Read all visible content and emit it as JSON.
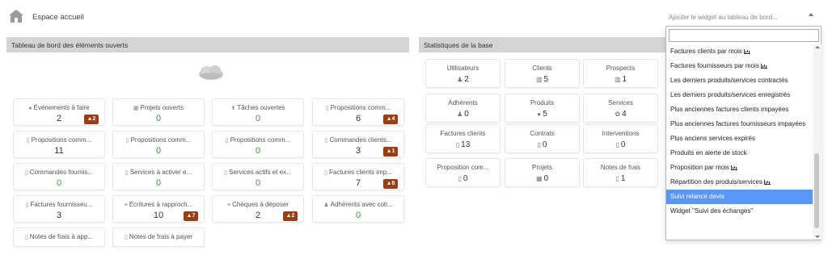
{
  "page": {
    "title": "Espace accueil",
    "left_panel_title": "Tableau de bord des éléments ouverts",
    "right_panel_title": "Statistiques de la base"
  },
  "open_items": [
    {
      "icon": "calendar-icon",
      "glyph": "●",
      "label": "Événements à faire",
      "value": "2",
      "warning": "2"
    },
    {
      "icon": "project-icon",
      "glyph": "▦",
      "label": "Projets ouverts",
      "value": "0",
      "warning": ""
    },
    {
      "icon": "task-icon",
      "glyph": "⬆",
      "label": "Tâches ouvertes",
      "value": "0",
      "warning": ""
    },
    {
      "icon": "proposal-icon",
      "glyph": "▯",
      "label": "Propositions comm...",
      "value": "6",
      "warning": "4"
    },
    {
      "icon": "proposal-icon",
      "glyph": "▯",
      "label": "Propositions comm...",
      "value": "11",
      "warning": ""
    },
    {
      "icon": "proposal-icon",
      "glyph": "▯",
      "label": "Propositions comm...",
      "value": "0",
      "warning": ""
    },
    {
      "icon": "proposal-icon",
      "glyph": "▯",
      "label": "Propositions comm...",
      "value": "0",
      "warning": ""
    },
    {
      "icon": "order-icon",
      "glyph": "▯",
      "label": "Commandes clients...",
      "value": "3",
      "warning": "1"
    },
    {
      "icon": "supplier-order-icon",
      "glyph": "▯",
      "label": "Commandes fournis...",
      "value": "0",
      "warning": ""
    },
    {
      "icon": "service-icon",
      "glyph": "▯",
      "label": "Services à activer e...",
      "value": "0",
      "warning": ""
    },
    {
      "icon": "service-icon",
      "glyph": "▯",
      "label": "Services actifs et ex...",
      "value": "0",
      "warning": ""
    },
    {
      "icon": "invoice-icon",
      "glyph": "▯",
      "label": "Factures clients imp...",
      "value": "7",
      "warning": "6"
    },
    {
      "icon": "supplier-invoice-icon",
      "glyph": "▯",
      "label": "Factures fournisseu...",
      "value": "3",
      "warning": ""
    },
    {
      "icon": "bank-icon",
      "glyph": "≡",
      "label": "Écritures à rapproch...",
      "value": "10",
      "warning": "7"
    },
    {
      "icon": "cheque-icon",
      "glyph": "≡",
      "label": "Chèques à déposer",
      "value": "2",
      "warning": "2"
    },
    {
      "icon": "member-icon",
      "glyph": "♟",
      "label": "Adhérents avec coti...",
      "value": "0",
      "warning": ""
    },
    {
      "icon": "expense-icon",
      "glyph": "▯",
      "label": "Notes de frais à app...",
      "value": "",
      "warning": ""
    },
    {
      "icon": "expense-icon",
      "glyph": "▯",
      "label": "Notes de frais à payer",
      "value": "",
      "warning": ""
    }
  ],
  "stats": [
    {
      "icon": "user-icon",
      "glyph": "♟",
      "label": "Utilisateurs",
      "value": "2"
    },
    {
      "icon": "company-icon",
      "glyph": "▥",
      "label": "Clients",
      "value": "5"
    },
    {
      "icon": "company-icon",
      "glyph": "▥",
      "label": "Prospects",
      "value": "1"
    },
    {
      "icon": "member-icon",
      "glyph": "♟",
      "label": "Adhérents",
      "value": "0"
    },
    {
      "icon": "product-icon",
      "glyph": "●",
      "label": "Produits",
      "value": "5"
    },
    {
      "icon": "service-icon",
      "glyph": "✿",
      "label": "Services",
      "value": "4"
    },
    {
      "icon": "invoice-icon",
      "glyph": "▯",
      "label": "Factures clients",
      "value": "13"
    },
    {
      "icon": "contract-icon",
      "glyph": "▯",
      "label": "Contrats",
      "value": "0"
    },
    {
      "icon": "intervention-icon",
      "glyph": "▯",
      "label": "Interventions",
      "value": "0"
    },
    {
      "icon": "proposal-icon",
      "glyph": "▯",
      "label": "Proposition com...",
      "value": "0"
    },
    {
      "icon": "project-icon",
      "glyph": "▦",
      "label": "Projets",
      "value": "0"
    },
    {
      "icon": "expense-icon",
      "glyph": "▯",
      "label": "Notes de frais",
      "value": "1"
    }
  ],
  "widget_select": {
    "placeholder": "Ajouter le widget au tableau de bord...",
    "search_value": "",
    "options": [
      {
        "label": "Factures clients par mois",
        "chart": true,
        "highlighted": false
      },
      {
        "label": "Factures fournisseurs par mois",
        "chart": true,
        "highlighted": false
      },
      {
        "label": "Les derniers produits/services contractés",
        "chart": false,
        "highlighted": false
      },
      {
        "label": "Les derniers produits/services enregistrés",
        "chart": false,
        "highlighted": false
      },
      {
        "label": "Plus anciennes factures clients impayées",
        "chart": false,
        "highlighted": false
      },
      {
        "label": "Plus anciennes factures fournisseurs impayées",
        "chart": false,
        "highlighted": false
      },
      {
        "label": "Plus anciens services expirés",
        "chart": false,
        "highlighted": false
      },
      {
        "label": "Produits en alerte de stock",
        "chart": false,
        "highlighted": false
      },
      {
        "label": "Proposition par mois",
        "chart": true,
        "highlighted": false
      },
      {
        "label": "Répartition des produis/services",
        "chart": true,
        "highlighted": false
      },
      {
        "label": "Suivi relance devis",
        "chart": false,
        "highlighted": true
      },
      {
        "label": "Widget \"Suivi des échanges\"",
        "chart": false,
        "highlighted": false
      }
    ]
  },
  "colors": {
    "warning_badge": "#9e3d14",
    "highlight": "#5897fb",
    "header_bg": "#d4d4d4",
    "green_value": "#3a9a3a"
  }
}
